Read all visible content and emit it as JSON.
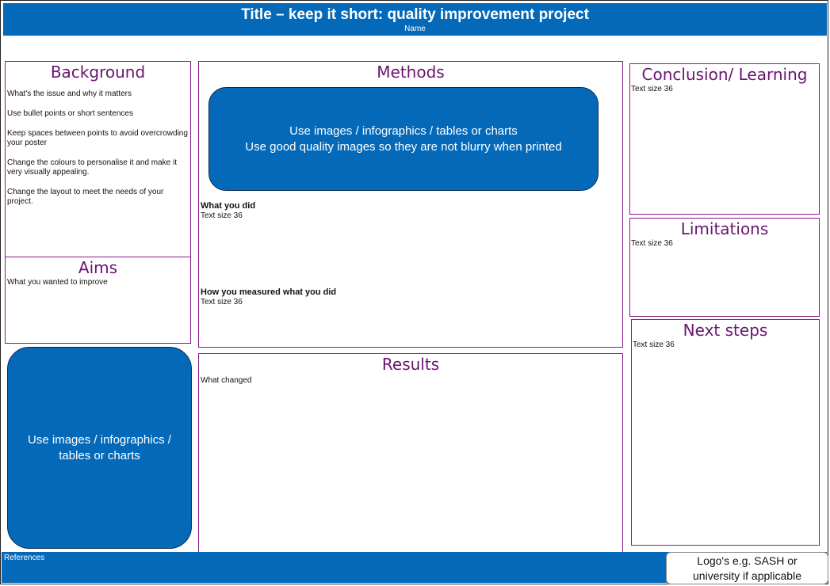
{
  "header": {
    "title": "Title – keep it short: quality improvement project",
    "name": "Name"
  },
  "background": {
    "heading": "Background",
    "points": [
      "What's the issue and why it matters",
      "Use bullet points or  short sentences",
      "Keep spaces between points to avoid overcrowding your poster",
      "Change the colours to personalise it and make it very visually appealing.",
      "Change the layout to meet the needs of your project."
    ]
  },
  "aims": {
    "heading": "Aims",
    "text": "What you wanted to improve"
  },
  "left_image": {
    "line1": "Use images / infographics /",
    "line2": "tables or charts"
  },
  "methods": {
    "heading": "Methods",
    "image_line1": "Use images / infographics / tables or charts",
    "image_line2": "Use good quality images so they are not blurry when printed",
    "what_heading": "What you did",
    "what_text": "Text size 36",
    "how_heading": "How you measured what you did",
    "how_text": "Text size 36"
  },
  "results": {
    "heading": "Results",
    "text": "What changed"
  },
  "conclusion": {
    "heading": "Conclusion/ Learning",
    "text": "Text size 36"
  },
  "limitations": {
    "heading": "Limitations",
    "text": "Text size 36"
  },
  "next_steps": {
    "heading": "Next steps",
    "text": "Text size 36"
  },
  "footer": {
    "references": "References",
    "logo_line1": "Logo's e.g. SASH or",
    "logo_line2": "university if applicable"
  },
  "colors": {
    "brand_blue": "#0469b9",
    "heading_purple": "#6a1470",
    "border_magenta": "#8b1a8b"
  }
}
